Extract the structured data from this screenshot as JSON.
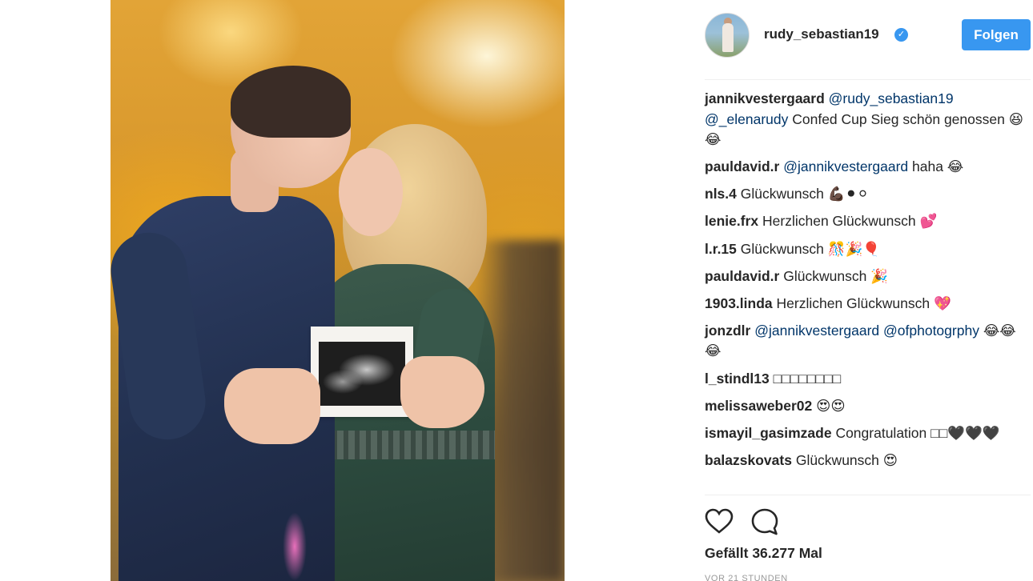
{
  "post": {
    "image_alt": ""
  },
  "header": {
    "username": "rudy_sebastian19",
    "verified_icon": "verified-badge-icon",
    "follow_label": "Folgen"
  },
  "colors": {
    "accent": "#3897f0",
    "mention": "#003569",
    "text": "#262626",
    "muted": "#999999"
  },
  "comments": [
    {
      "user": "jannikvestergaard",
      "mentions": [
        "@rudy_sebastian19",
        "@_elenarudy"
      ],
      "text": "Confed Cup Sieg schön genossen 😆😂"
    },
    {
      "user": "pauldavid.r",
      "mentions": [
        "@jannikvestergaard"
      ],
      "text": "haha 😂"
    },
    {
      "user": "nls.4",
      "mentions": [],
      "text": "Glückwunsch 💪🏿⚫⚪"
    },
    {
      "user": "lenie.frx",
      "mentions": [],
      "text": "Herzlichen Glückwunsch 💕"
    },
    {
      "user": "l.r.15",
      "mentions": [],
      "text": "Glückwunsch 🎊🎉🎈"
    },
    {
      "user": "pauldavid.r",
      "mentions": [],
      "text": "Glückwunsch 🎉"
    },
    {
      "user": "1903.linda",
      "mentions": [],
      "text": "Herzlichen Glückwunsch 💖"
    },
    {
      "user": "jonzdlr",
      "mentions": [
        "@jannikvestergaard",
        "@ofphotogrphy"
      ],
      "text": "😂😂😂"
    },
    {
      "user": "l_stindl13",
      "mentions": [],
      "text": "□□□□□□□□"
    },
    {
      "user": "melissaweber02",
      "mentions": [],
      "text": "😍😍"
    },
    {
      "user": "ismayil_gasimzade",
      "mentions": [],
      "text": "Congratulation □□🖤🖤🖤"
    },
    {
      "user": "balazskovats",
      "mentions": [],
      "text": "Glückwunsch 😍"
    }
  ],
  "actions": {
    "like_icon": "heart-icon",
    "comment_icon": "comment-bubble-icon"
  },
  "likes_text": "Gefällt 36.277 Mal",
  "timestamp": "VOR 21 STUNDEN"
}
